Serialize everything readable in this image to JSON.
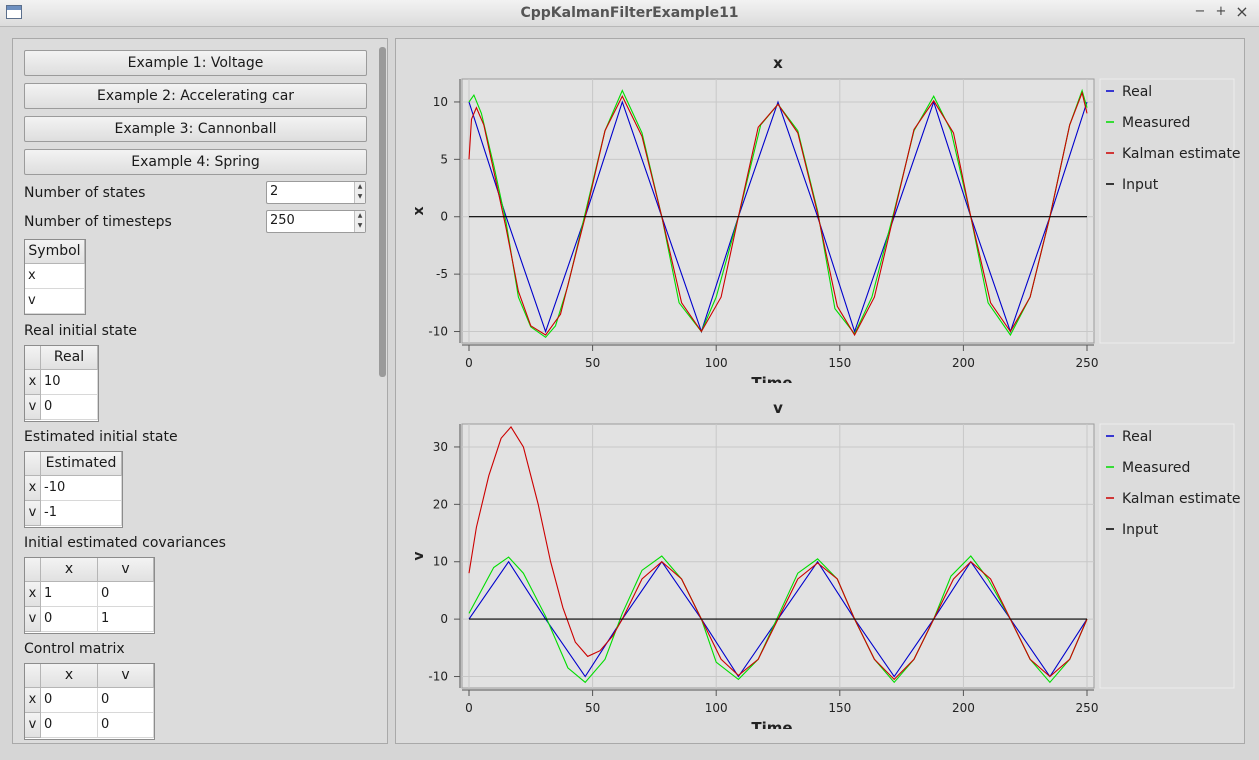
{
  "window": {
    "title": "CppKalmanFilterExample11",
    "minimize": "−",
    "maximize": "+",
    "close": "×"
  },
  "buttons": [
    "Example 1: Voltage",
    "Example 2: Accelerating car",
    "Example 3: Cannonball",
    "Example 4: Spring"
  ],
  "num_states": {
    "label": "Number of states",
    "value": "2"
  },
  "num_timesteps": {
    "label": "Number of timesteps",
    "value": "250"
  },
  "symbol_table": {
    "header": "Symbol",
    "rows": [
      "x",
      "v"
    ]
  },
  "real_initial_state": {
    "label": "Real initial state",
    "header": "Real",
    "row_headers": [
      "x",
      "v"
    ],
    "values": [
      "10",
      "0"
    ]
  },
  "estimated_initial_state": {
    "label": "Estimated initial state",
    "header": "Estimated",
    "row_headers": [
      "x",
      "v"
    ],
    "values": [
      "-10",
      "-1"
    ]
  },
  "initial_covariances": {
    "label": "Initial estimated covariances",
    "col_headers": [
      "x",
      "v"
    ],
    "row_headers": [
      "x",
      "v"
    ],
    "values": [
      [
        "1",
        "0"
      ],
      [
        "0",
        "1"
      ]
    ]
  },
  "control_matrix": {
    "label": "Control matrix",
    "col_headers": [
      "x",
      "v"
    ],
    "row_headers": [
      "x",
      "v"
    ],
    "values": [
      [
        "0",
        "0"
      ],
      [
        "0",
        "0"
      ]
    ]
  },
  "colors": {
    "real": "#0000cc",
    "measured": "#00dd00",
    "kalman": "#cc0000",
    "input": "#000000"
  },
  "chart_data": [
    {
      "type": "line",
      "title": "x",
      "xlabel": "Time",
      "ylabel": "x",
      "xlim": [
        0,
        250
      ],
      "ylim": [
        -11,
        12
      ],
      "xticks": [
        "0",
        "50",
        "100",
        "150",
        "200",
        "250"
      ],
      "yticks": [
        "-10",
        "-5",
        "0",
        "5",
        "10"
      ],
      "grid": true,
      "legend": "right",
      "series": [
        {
          "name": "Real",
          "color": "#0000cc",
          "x": [
            0,
            15,
            31,
            47,
            62,
            78,
            94,
            109,
            125,
            141,
            156,
            172,
            188,
            203,
            219,
            235,
            250
          ],
          "y": [
            10,
            0,
            -10,
            0,
            10,
            0,
            -10,
            0,
            10,
            0,
            -10,
            0,
            10,
            0,
            -10,
            0,
            10
          ]
        },
        {
          "name": "Measured",
          "color": "#00dd00",
          "x": [
            0,
            2,
            5,
            10,
            15,
            20,
            25,
            31,
            35,
            40,
            47,
            55,
            62,
            70,
            78,
            85,
            94,
            100,
            109,
            118,
            125,
            133,
            141,
            148,
            156,
            163,
            172,
            180,
            188,
            195,
            203,
            210,
            219,
            227,
            235,
            243,
            248,
            250
          ],
          "y": [
            10,
            10.6,
            9,
            4.5,
            -0.5,
            -7,
            -9.6,
            -10.5,
            -9.5,
            -6,
            0.3,
            7.5,
            11,
            7.3,
            0,
            -7.5,
            -10,
            -7,
            0,
            8,
            9.8,
            7.5,
            0.5,
            -8,
            -10.2,
            -7,
            0.5,
            7.5,
            10.5,
            7.5,
            0,
            -7.5,
            -10.3,
            -7,
            0,
            8,
            11,
            9.5
          ]
        },
        {
          "name": "Kalman estimate",
          "color": "#cc0000",
          "x": [
            0,
            1,
            3,
            6,
            10,
            15,
            20,
            25,
            31,
            37,
            47,
            55,
            62,
            70,
            78,
            86,
            94,
            102,
            109,
            117,
            125,
            133,
            141,
            149,
            156,
            164,
            172,
            180,
            188,
            196,
            203,
            211,
            219,
            227,
            235,
            243,
            248,
            250
          ],
          "y": [
            5,
            8.5,
            9.5,
            8,
            4,
            -1,
            -6.5,
            -9.5,
            -10.3,
            -8.5,
            0,
            7.5,
            10.5,
            7,
            0,
            -7.5,
            -10,
            -7,
            0,
            7.8,
            9.8,
            7.3,
            0.3,
            -7.8,
            -10.3,
            -7,
            0.3,
            7.6,
            10.1,
            7.3,
            0,
            -7.5,
            -10,
            -7,
            0,
            8,
            10.8,
            9
          ]
        },
        {
          "name": "Input",
          "color": "#000000",
          "x": [
            0,
            250
          ],
          "y": [
            0,
            0
          ]
        }
      ]
    },
    {
      "type": "line",
      "title": "v",
      "xlabel": "Time",
      "ylabel": "v",
      "xlim": [
        0,
        250
      ],
      "ylim": [
        -12,
        34
      ],
      "xticks": [
        "0",
        "50",
        "100",
        "150",
        "200",
        "250"
      ],
      "yticks": [
        "-10",
        "0",
        "10",
        "20",
        "30"
      ],
      "grid": true,
      "legend": "right",
      "series": [
        {
          "name": "Real",
          "color": "#0000cc",
          "x": [
            0,
            16,
            31,
            47,
            62,
            78,
            94,
            109,
            125,
            141,
            156,
            172,
            188,
            203,
            219,
            235,
            250
          ],
          "y": [
            0,
            10,
            0,
            -10,
            0,
            10,
            0,
            -10,
            0,
            10,
            0,
            -10,
            0,
            10,
            0,
            -10,
            0
          ]
        },
        {
          "name": "Measured",
          "color": "#00dd00",
          "x": [
            0,
            5,
            10,
            16,
            22,
            31,
            40,
            47,
            55,
            62,
            70,
            78,
            86,
            94,
            100,
            109,
            117,
            125,
            133,
            141,
            149,
            156,
            164,
            172,
            180,
            188,
            195,
            203,
            210,
            219,
            227,
            235,
            243,
            250
          ],
          "y": [
            1,
            5,
            9,
            10.8,
            8,
            0.5,
            -8.5,
            -11,
            -7,
            1,
            8.5,
            11,
            7,
            0,
            -7.5,
            -10.5,
            -7,
            0.5,
            8,
            10.5,
            7,
            0,
            -7,
            -11,
            -7,
            0,
            7.5,
            11,
            7,
            0,
            -7,
            -11,
            -7,
            0
          ]
        },
        {
          "name": "Kalman estimate",
          "color": "#cc0000",
          "x": [
            0,
            3,
            8,
            13,
            17,
            22,
            28,
            33,
            38,
            43,
            48,
            53,
            58,
            62,
            70,
            78,
            86,
            94,
            102,
            109,
            117,
            125,
            133,
            141,
            149,
            156,
            164,
            172,
            180,
            188,
            196,
            203,
            211,
            219,
            227,
            235,
            243,
            250
          ],
          "y": [
            8,
            16,
            25,
            31.5,
            33.5,
            30,
            20,
            10,
            2,
            -4,
            -6.5,
            -5.5,
            -3,
            0,
            7,
            10,
            7,
            0,
            -7,
            -9.8,
            -7,
            0,
            7,
            9.8,
            7,
            0,
            -7,
            -10.5,
            -7,
            0,
            7,
            10,
            7,
            0,
            -7,
            -10,
            -7,
            0
          ]
        },
        {
          "name": "Input",
          "color": "#000000",
          "x": [
            0,
            250
          ],
          "y": [
            0,
            0
          ]
        }
      ]
    }
  ]
}
